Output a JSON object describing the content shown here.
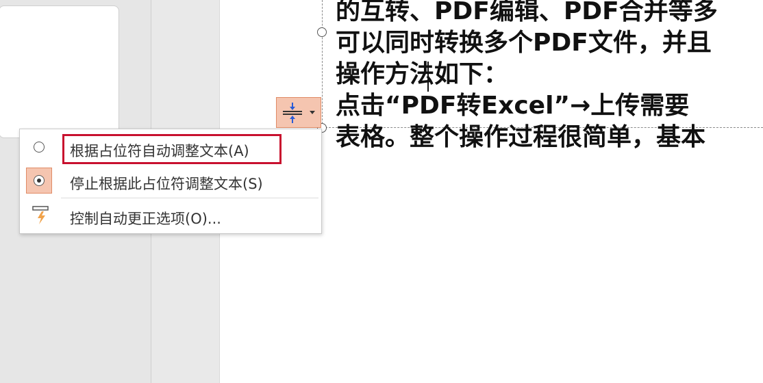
{
  "slide": {
    "lines": [
      "的互转、PDF编辑、PDF合并等多",
      "可以同时转换多个PDF文件，并且",
      "操作方法如下：",
      "点击“PDF转Excel”→上传需要",
      "表格。整个操作过程很简单，基本"
    ]
  },
  "autofit_button": {
    "icon": "autofit-options-icon",
    "accent": "#f5c5b0",
    "border": "#e08b66"
  },
  "menu": {
    "items": [
      {
        "label": "根据占位符自动调整文本(A)",
        "state": "unselected",
        "highlighted": true
      },
      {
        "label": "停止根据此占位符调整文本(S)",
        "state": "selected"
      },
      {
        "label": "控制自动更正选项(O)...",
        "icon": "autocorrect-lightning-icon"
      }
    ],
    "highlight_color": "#c8102e"
  }
}
